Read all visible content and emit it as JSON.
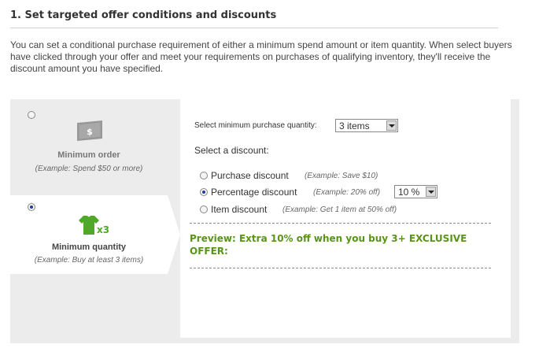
{
  "section": {
    "title": "1. Set targeted offer conditions and discounts",
    "intro": "You can set a conditional purchase requirement of either a minimum spend amount or item quantity. When select buyers have clicked through your offer and meet your requirements on purchases of qualifying inventory, they'll receive the discount amount you have specified."
  },
  "condition_options": [
    {
      "label": "Minimum order",
      "example": "(Example: Spend $50 or more)",
      "selected": false,
      "icon": "dollar-bill-icon",
      "icon_text": "$"
    },
    {
      "label": "Minimum quantity",
      "example": "(Example: Buy at least 3 items)",
      "selected": true,
      "icon": "tshirt-x3-icon",
      "icon_text": "x3"
    }
  ],
  "quantity": {
    "label": "Select minimum purchase quantity:",
    "selected": "3 items"
  },
  "discount": {
    "label": "Select a discount:",
    "options": [
      {
        "label": "Purchase discount",
        "example": "(Example: Save $10)",
        "selected": false
      },
      {
        "label": "Percentage discount",
        "example": "(Example: 20% off)",
        "selected": true,
        "value": "10 %"
      },
      {
        "label": "Item discount",
        "example": "(Example: Get 1 item at 50% off)",
        "selected": false
      }
    ]
  },
  "preview": {
    "text": "Preview: Extra 10% off when you buy 3+ EXCLUSIVE OFFER:"
  },
  "colors": {
    "preview_green": "#5a9416",
    "tshirt_green": "#4fa82a",
    "panel_gray": "#ececec",
    "radio_selected": "#1f3e9c"
  }
}
